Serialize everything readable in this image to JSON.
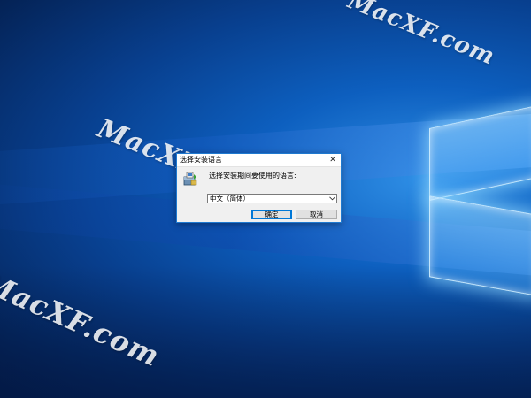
{
  "watermark": {
    "text_main": "MacXF.com",
    "text_bottom": "MacXF.com",
    "text_top": "MacXF.com"
  },
  "dialog": {
    "title": "选择安装语言",
    "close_glyph": "✕",
    "prompt": "选择安装期间要使用的语言:",
    "language_select": {
      "selected": "中文（简体）"
    },
    "ok_label": "确定",
    "cancel_label": "取消"
  },
  "colors": {
    "accent": "#0078d7",
    "dialog_bg": "#f0f0f0",
    "desktop_blue": "#0d5fbf"
  },
  "icons": {
    "installer": "installer-package-icon",
    "combo_arrow": "chevron-down-icon",
    "close": "close-icon"
  }
}
